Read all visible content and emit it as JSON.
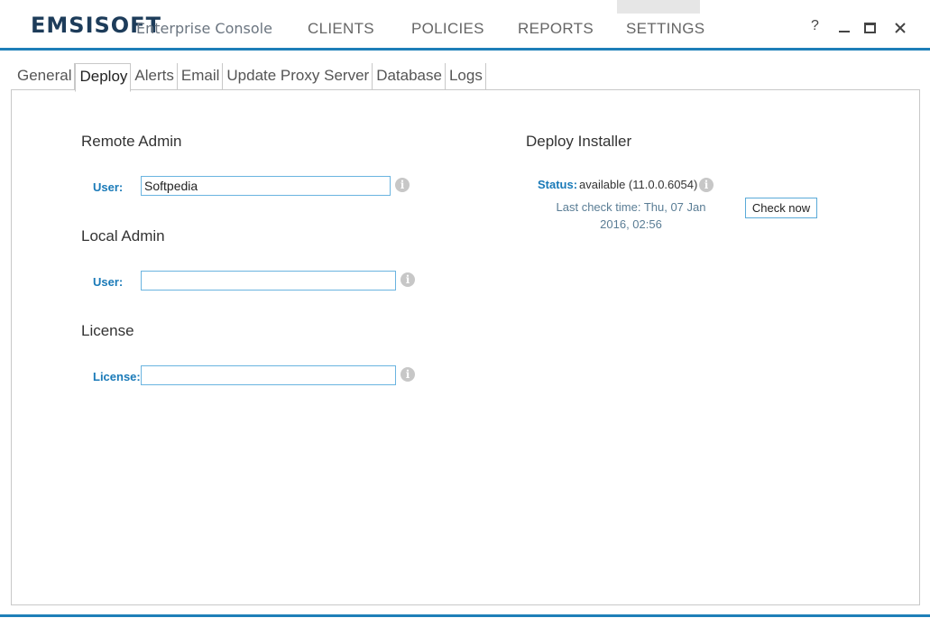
{
  "app": {
    "brand": "EMSISOFT",
    "product": "Enterprise Console"
  },
  "nav": {
    "clients": "CLIENTS",
    "policies": "POLICIES",
    "reports": "REPORTS",
    "settings": "SETTINGS",
    "active": "SETTINGS"
  },
  "window_controls": {
    "help": "?",
    "minimize": "_",
    "maximize": "□",
    "close": "✕"
  },
  "tabs": [
    "General",
    "Deploy",
    "Alerts",
    "Email",
    "Update Proxy Server",
    "Database",
    "Logs"
  ],
  "active_tab": "Deploy",
  "remote_admin": {
    "title": "Remote Admin",
    "user_label": "User:",
    "user_value": "Softpedia"
  },
  "local_admin": {
    "title": "Local Admin",
    "user_label": "User:",
    "user_value": ""
  },
  "license": {
    "title": "License",
    "license_label": "License:",
    "license_value": ""
  },
  "deploy_installer": {
    "title": "Deploy Installer",
    "status_label": "Status:",
    "status_value": "available (11.0.0.6054)",
    "last_check_line1": "Last check time: Thu, 07 Jan",
    "last_check_line2": "2016, 02:56",
    "check_button": "Check now"
  },
  "colors": {
    "accent": "#1e7fb8",
    "label_blue": "#1a7ab8",
    "brand": "#1d3c5a"
  }
}
